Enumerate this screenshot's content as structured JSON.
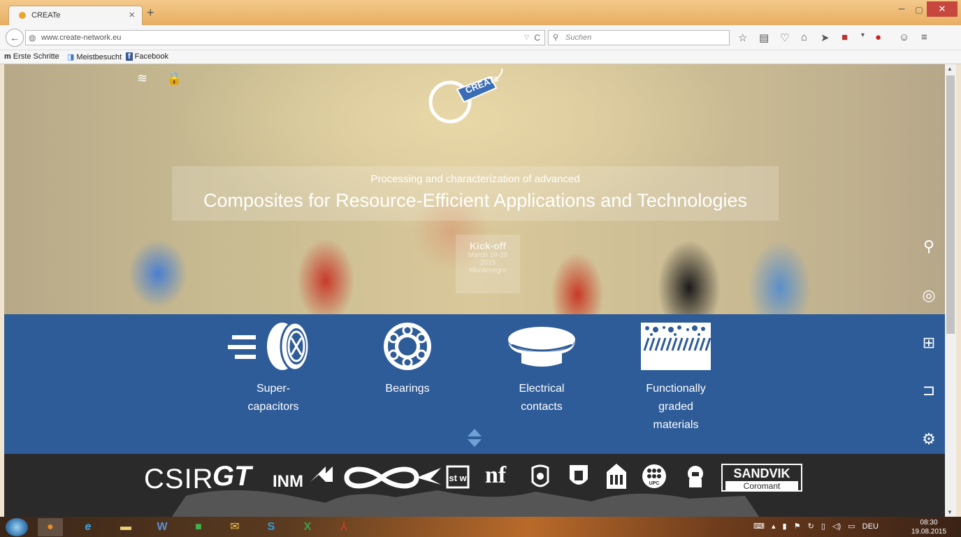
{
  "browser": {
    "tab_title": "CREATe",
    "url": "www.create-network.eu",
    "search_placeholder": "Suchen",
    "bookmarks": [
      {
        "label": "Erste Schritte"
      },
      {
        "label": "Meistbesucht"
      },
      {
        "label": "Facebook"
      }
    ]
  },
  "hero": {
    "logo_text": "CREATe",
    "subtitle": "Processing and characterization of advanced",
    "title": "Composites for Resource-Efficient Applications and Technologies",
    "kickoff_title": "Kick-off",
    "kickoff_dates": "March 19-20",
    "kickoff_year": "2015",
    "kickoff_place": "Montenegro"
  },
  "topics": [
    {
      "label_line1": "Super-",
      "label_line2": "capacitors",
      "label_line3": ""
    },
    {
      "label_line1": "Bearings",
      "label_line2": "",
      "label_line3": ""
    },
    {
      "label_line1": "Electrical",
      "label_line2": "contacts",
      "label_line3": ""
    },
    {
      "label_line1": "Functionally",
      "label_line2": "graded",
      "label_line3": "materials"
    }
  ],
  "partners": {
    "csir": "CSIR",
    "gt": "GT",
    "inm": "INM",
    "sandvik_top": "SANDVIK",
    "sandvik_bottom": "Coromant",
    "stw": "st w",
    "upc": "UPC"
  },
  "side_tools": [
    "search-icon",
    "ubuntu-icon",
    "windows-icon",
    "login-icon",
    "gear-icon"
  ],
  "taskbar": {
    "lang": "DEU",
    "time": "08:30",
    "date": "19.08.2015"
  },
  "colors": {
    "topics_bg": "#2e5c98",
    "partners_bg": "#2a2a2a",
    "titlebar": "#e8ae62",
    "close_button": "#c7463e"
  }
}
